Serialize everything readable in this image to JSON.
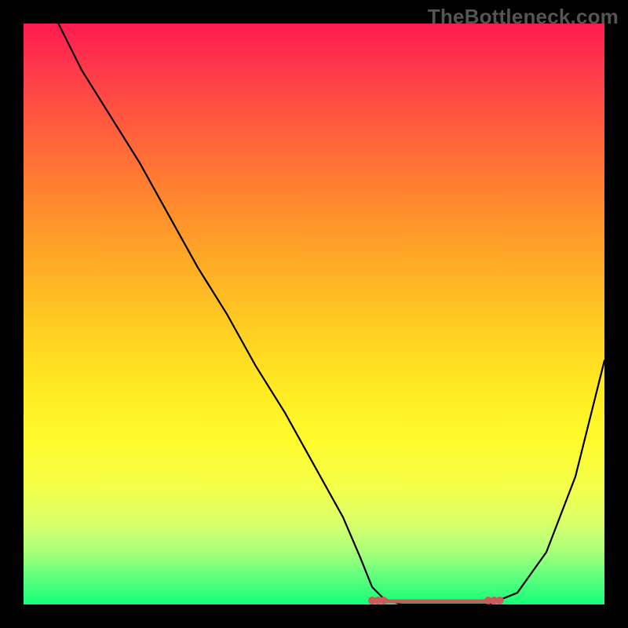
{
  "watermark": "TheBottleneck.com",
  "chart_data": {
    "type": "line",
    "title": "",
    "xlabel": "",
    "ylabel": "",
    "xlim": [
      0,
      100
    ],
    "ylim": [
      0,
      100
    ],
    "series": [
      {
        "name": "bottleneck-curve",
        "x": [
          6,
          10,
          15,
          20,
          25,
          30,
          35,
          40,
          45,
          50,
          55,
          58,
          60,
          62,
          65,
          70,
          75,
          80,
          85,
          90,
          95,
          100
        ],
        "values": [
          100,
          92,
          84,
          76,
          67,
          58,
          50,
          41,
          33,
          24,
          15,
          8,
          3,
          1,
          0,
          0,
          0,
          0,
          2,
          9,
          22,
          42
        ]
      }
    ],
    "markers": {
      "flat_region_x": [
        60,
        82
      ],
      "dots_x": [
        60,
        61,
        62,
        80,
        81,
        82
      ]
    },
    "background_gradient": {
      "top": "#ff1a4f",
      "bottom": "#14ff77"
    }
  }
}
